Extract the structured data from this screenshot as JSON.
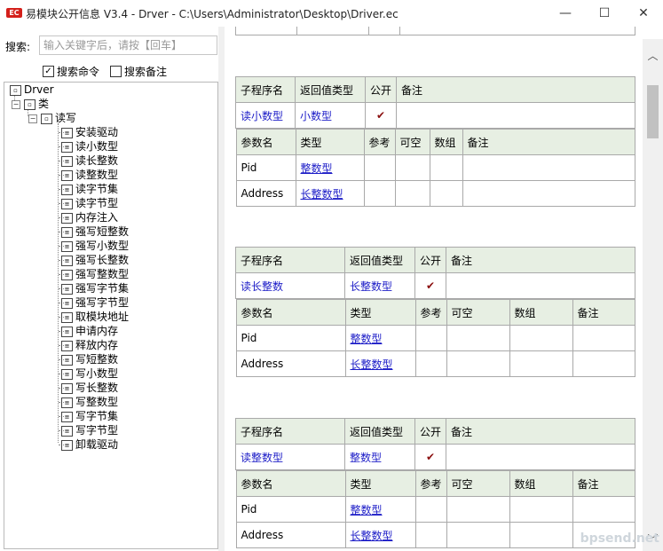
{
  "window": {
    "app_icon": "EC",
    "title": "易模块公开信息 V3.4 - Drver - C:\\Users\\Administrator\\Desktop\\Driver.ec",
    "minimize": "—",
    "maximize": "☐",
    "close": "✕"
  },
  "search": {
    "label": "搜索:",
    "placeholder": "输入关键字后，请按【回车】",
    "value": "",
    "check_commands": "搜索命令",
    "check_commands_checked": true,
    "check_notes": "搜索备注",
    "check_notes_checked": false
  },
  "tree": {
    "root": "Drver",
    "class_node": "类",
    "group_node": "读写",
    "items": [
      "安装驱动",
      "读小数型",
      "读长整数",
      "读整数型",
      "读字节集",
      "读字节型",
      "内存注入",
      "强写短整数",
      "强写小数型",
      "强写长整数",
      "强写整数型",
      "强写字节集",
      "强写字节型",
      "取模块地址",
      "申请内存",
      "释放内存",
      "写短整数",
      "写小数型",
      "写长整数",
      "写整数型",
      "写字节集",
      "写字节型",
      "卸载驱动"
    ]
  },
  "doc": {
    "col_sub": "子程序名",
    "col_ret": "返回值类型",
    "col_pub": "公开",
    "col_note": "备注",
    "col_param": "参数名",
    "col_type": "类型",
    "col_ref": "参考",
    "col_opt": "可空",
    "col_arr": "数组",
    "check": "✔",
    "tables": [
      {
        "name": "读小数型",
        "ret": "小数型",
        "params": [
          {
            "name": "Pid",
            "type": "整数型"
          },
          {
            "name": "Address",
            "type": "长整数型"
          }
        ]
      },
      {
        "name": "读长整数",
        "ret": "长整数型",
        "params": [
          {
            "name": "Pid",
            "type": "整数型"
          },
          {
            "name": "Address",
            "type": "长整数型"
          }
        ]
      },
      {
        "name": "读整数型",
        "ret": "整数型",
        "params": [
          {
            "name": "Pid",
            "type": "整数型"
          },
          {
            "name": "Address",
            "type": "长整数型"
          }
        ]
      }
    ]
  },
  "watermark": "bpsend.net"
}
